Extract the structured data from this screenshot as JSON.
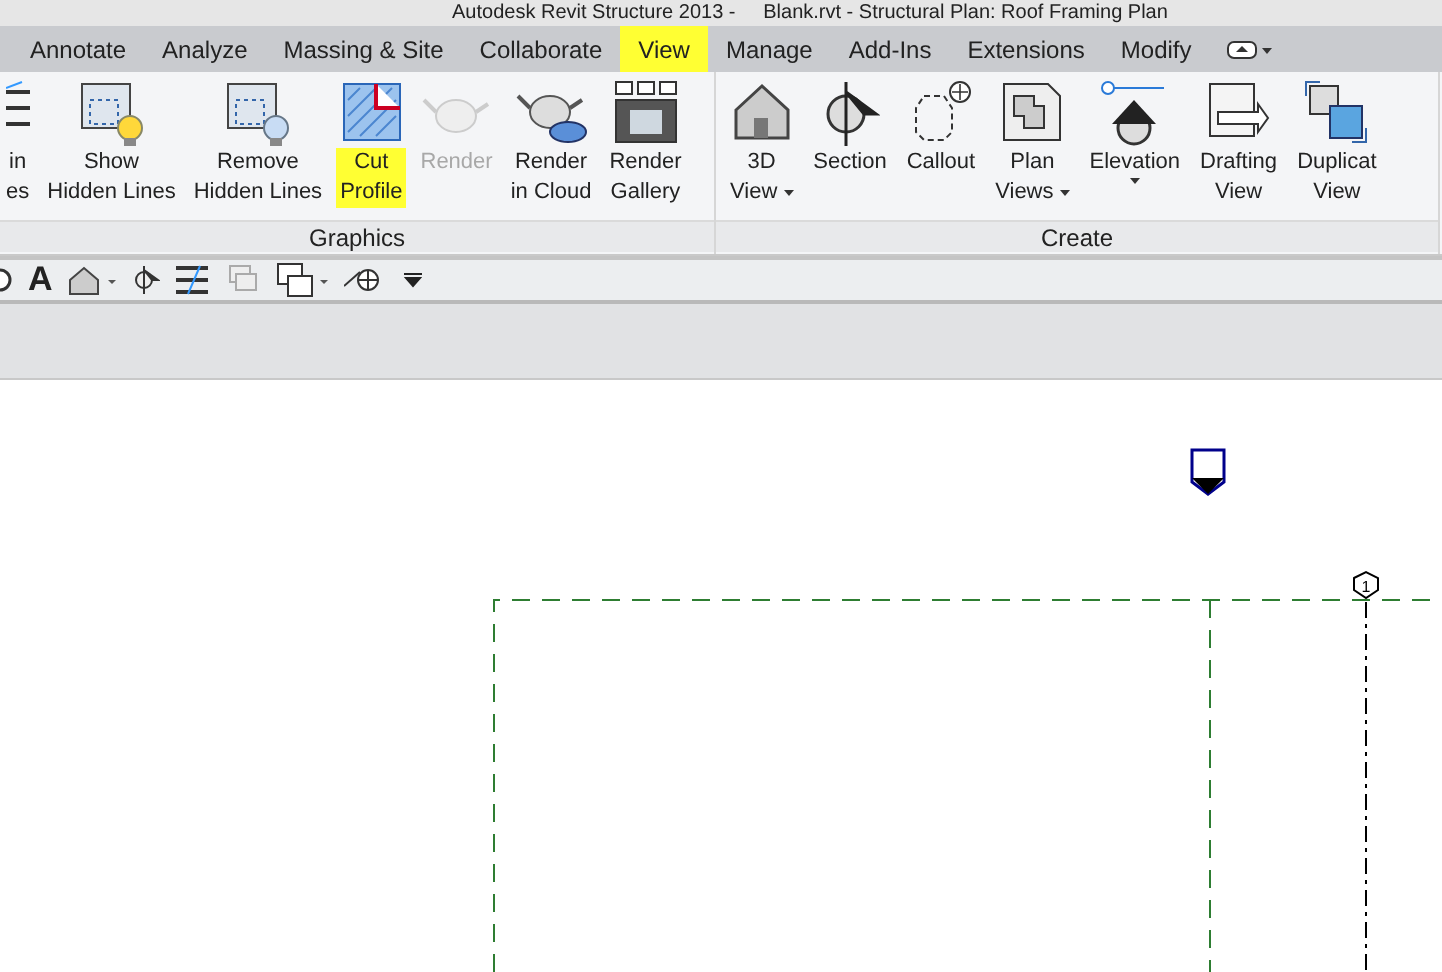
{
  "window": {
    "title": "Autodesk Revit Structure 2013 -     Blank.rvt - Structural Plan: Roof Framing Plan"
  },
  "tabs": [
    {
      "label": "Annotate",
      "selected": false
    },
    {
      "label": "Analyze",
      "selected": false
    },
    {
      "label": "Massing & Site",
      "selected": false
    },
    {
      "label": "Collaborate",
      "selected": false
    },
    {
      "label": "View",
      "selected": true
    },
    {
      "label": "Manage",
      "selected": false
    },
    {
      "label": "Add-Ins",
      "selected": false
    },
    {
      "label": "Extensions",
      "selected": false
    },
    {
      "label": "Modify",
      "selected": false
    }
  ],
  "panels": [
    {
      "title": "Graphics",
      "buttons": [
        {
          "lines": [
            "in",
            "es"
          ],
          "disabled": false,
          "highlighted": false,
          "dropdown": false
        },
        {
          "lines": [
            "Show",
            "Hidden Lines"
          ],
          "disabled": false,
          "highlighted": false,
          "dropdown": false
        },
        {
          "lines": [
            "Remove",
            "Hidden Lines"
          ],
          "disabled": false,
          "highlighted": false,
          "dropdown": false
        },
        {
          "lines": [
            "Cut",
            "Profile"
          ],
          "disabled": false,
          "highlighted": true,
          "dropdown": false
        },
        {
          "lines": [
            "Render"
          ],
          "disabled": true,
          "highlighted": false,
          "dropdown": false
        },
        {
          "lines": [
            "Render",
            "in Cloud"
          ],
          "disabled": false,
          "highlighted": false,
          "dropdown": false
        },
        {
          "lines": [
            "Render",
            "Gallery"
          ],
          "disabled": false,
          "highlighted": false,
          "dropdown": false
        }
      ]
    },
    {
      "title": "Create",
      "buttons": [
        {
          "lines": [
            "3D",
            "View"
          ],
          "disabled": false,
          "highlighted": false,
          "dropdown": true
        },
        {
          "lines": [
            "Section"
          ],
          "disabled": false,
          "highlighted": false,
          "dropdown": false
        },
        {
          "lines": [
            "Callout"
          ],
          "disabled": false,
          "highlighted": false,
          "dropdown": false
        },
        {
          "lines": [
            "Plan",
            "Views"
          ],
          "disabled": false,
          "highlighted": false,
          "dropdown": true
        },
        {
          "lines": [
            "Elevation"
          ],
          "disabled": false,
          "highlighted": false,
          "dropdown": true
        },
        {
          "lines": [
            "Drafting",
            "View"
          ],
          "disabled": false,
          "highlighted": false,
          "dropdown": false
        },
        {
          "lines": [
            "Duplicat",
            "View"
          ],
          "disabled": false,
          "highlighted": false,
          "dropdown": false
        }
      ]
    }
  ],
  "toolbar": {
    "text_tool": "A"
  },
  "canvas": {
    "grid_label": "1"
  }
}
